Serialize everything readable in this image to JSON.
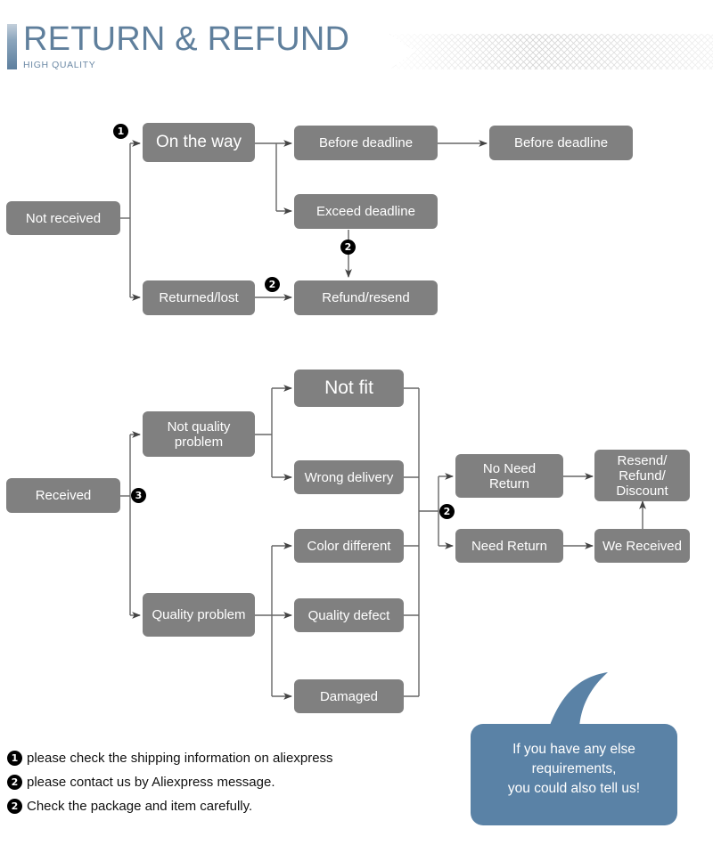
{
  "header": {
    "title": "RETURN & REFUND",
    "subtitle": "HIGH QUALITY",
    "accent_color": "#5d7f9e",
    "title_color": "#5f7f9c"
  },
  "theme": {
    "node_fill": "#808080",
    "node_text": "#ffffff",
    "connector": "#555555",
    "badge_fill": "#000000",
    "bubble_fill": "#5a82a6"
  },
  "flow_not_received": {
    "nodes": {
      "not_received": "Not received",
      "on_the_way": "On the way",
      "before_deadline_1": "Before deadline",
      "before_deadline_2": "Before deadline",
      "exceed_deadline": "Exceed deadline",
      "returned_lost": "Returned/lost",
      "refund_resend": "Refund/resend"
    },
    "badges": {
      "on_the_way": "1",
      "returned_lost": "2",
      "exceed_to_refund": "2"
    }
  },
  "flow_received": {
    "nodes": {
      "received": "Received",
      "not_quality_problem": "Not quality\nproblem",
      "quality_problem": "Quality problem",
      "not_fit": "Not fit",
      "wrong_delivery": "Wrong delivery",
      "color_different": "Color different",
      "quality_defect": "Quality defect",
      "damaged": "Damaged",
      "no_need_return": "No Need\nReturn",
      "need_return": "Need Return",
      "we_received": "We Received",
      "resend_refund_discount": "Resend/\nRefund/\nDiscount"
    },
    "badges": {
      "received": "3",
      "return_decision": "2"
    }
  },
  "legend": [
    {
      "badge": "1",
      "text": "please check the shipping information on aliexpress"
    },
    {
      "badge": "2",
      "text": "please contact us by Aliexpress message."
    },
    {
      "badge": "2",
      "text": "Check the package and item carefully."
    }
  ],
  "bubble": {
    "text": "If you have any else\nrequirements,\nyou could also tell us!"
  }
}
